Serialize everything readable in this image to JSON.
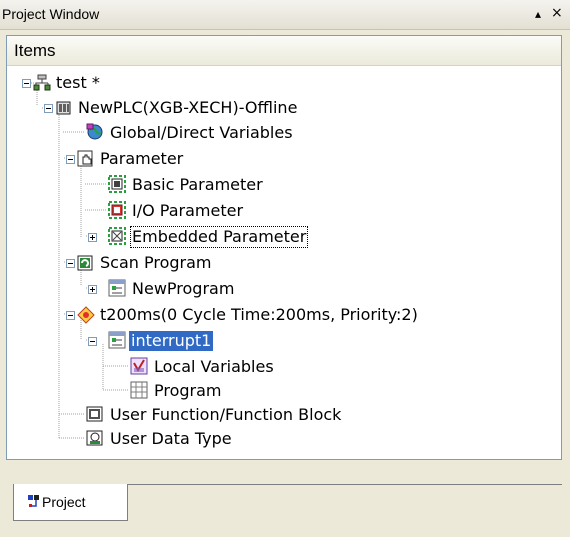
{
  "window": {
    "title": "Project Window",
    "pin_glyph": "▴",
    "close_glyph": "×"
  },
  "panel": {
    "header": "Items"
  },
  "tree": [
    {
      "label": "test *",
      "icon": "project-network-icon",
      "expander": "minus"
    },
    {
      "label": "NewPLC(XGB-XECH)-Offline",
      "icon": "plc-icon",
      "expander": "minus"
    },
    {
      "label": "Global/Direct Variables",
      "icon": "global-variables-icon",
      "expander": "none"
    },
    {
      "label": "Parameter",
      "icon": "parameter-hand-icon",
      "expander": "minus"
    },
    {
      "label": "Basic Parameter",
      "icon": "basic-parameter-icon",
      "expander": "none"
    },
    {
      "label": "I/O Parameter",
      "icon": "io-parameter-icon",
      "expander": "none"
    },
    {
      "label": "Embedded Parameter",
      "icon": "embedded-parameter-icon",
      "expander": "plus"
    },
    {
      "label": "Scan Program",
      "icon": "scan-program-icon",
      "expander": "minus"
    },
    {
      "label": "NewProgram",
      "icon": "program-icon",
      "expander": "plus"
    },
    {
      "label": "t200ms(0 Cycle Time:200ms, Priority:2)",
      "icon": "task-diamond-icon",
      "expander": "minus"
    },
    {
      "label": "interrupt1",
      "icon": "program-icon",
      "expander": "minus"
    },
    {
      "label": "Local Variables",
      "icon": "local-variables-icon",
      "expander": "none"
    },
    {
      "label": "Program",
      "icon": "program-body-icon",
      "expander": "none"
    },
    {
      "label": "User Function/Function Block",
      "icon": "user-function-icon",
      "expander": "none"
    },
    {
      "label": "User Data Type",
      "icon": "user-data-type-icon",
      "expander": "none"
    }
  ],
  "selected_item": "interrupt1",
  "focused_item": "Embedded Parameter",
  "tabs": [
    {
      "label": "Project",
      "icon": "project-tab-icon",
      "active": true
    }
  ],
  "colors": {
    "selection": "#316ac5",
    "tree_lines": "#a0a0a0",
    "panel_bg": "#ffffff",
    "chrome_bg": "#ece9d8"
  }
}
